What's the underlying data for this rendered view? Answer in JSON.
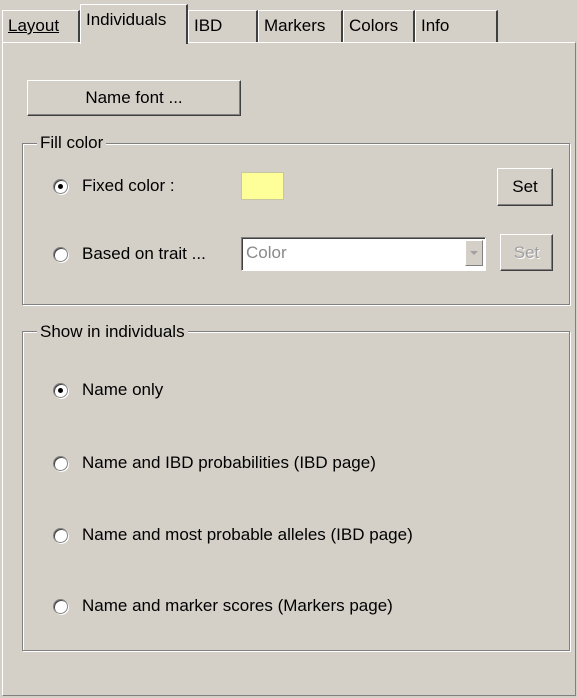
{
  "tabs": [
    {
      "label": "Layout",
      "active": false
    },
    {
      "label": "Individuals",
      "active": true
    },
    {
      "label": "IBD",
      "active": false
    },
    {
      "label": "Markers",
      "active": false
    },
    {
      "label": "Colors",
      "active": false
    },
    {
      "label": "Info",
      "active": false
    }
  ],
  "name_font_button": "Name font ...",
  "fill_color": {
    "legend": "Fill color",
    "fixed_label": "Fixed color :",
    "fixed_checked": true,
    "fixed_color": "#ffff99",
    "set_label": "Set",
    "trait_label": "Based on trait ...",
    "trait_checked": false,
    "trait_value": "Color",
    "trait_set_label": "Set"
  },
  "show": {
    "legend": "Show in individuals",
    "options": [
      {
        "label": "Name only",
        "checked": true
      },
      {
        "label": "Name and IBD probabilities (IBD page)",
        "checked": false
      },
      {
        "label": "Name and most probable alleles (IBD page)",
        "checked": false
      },
      {
        "label": "Name and marker scores (Markers page)",
        "checked": false
      }
    ]
  }
}
